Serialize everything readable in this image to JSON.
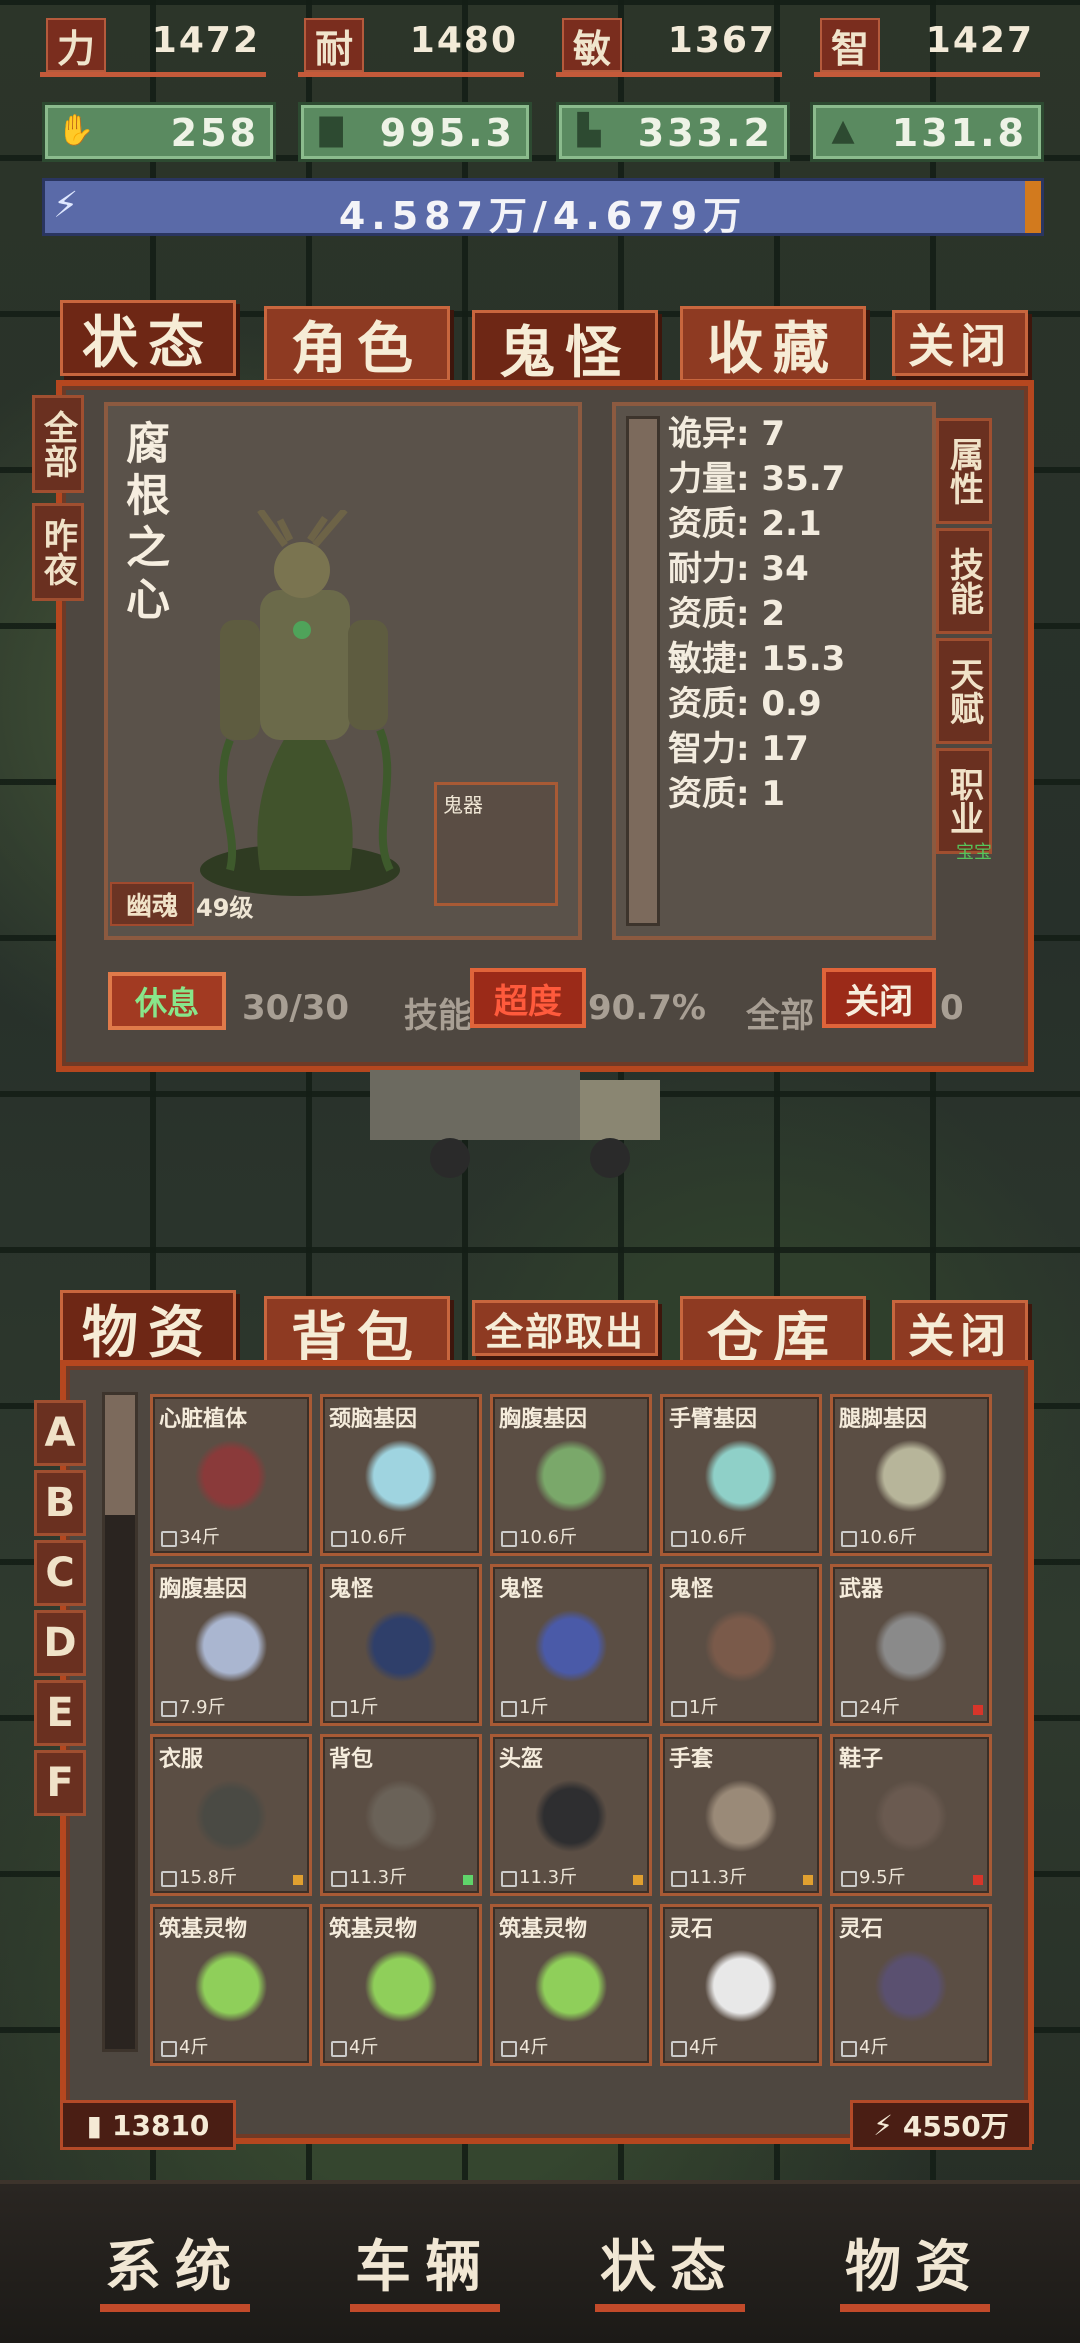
{
  "stats": [
    {
      "label": "力",
      "value": "1472"
    },
    {
      "label": "耐",
      "value": "1480"
    },
    {
      "label": "敏",
      "value": "1367"
    },
    {
      "label": "智",
      "value": "1427"
    }
  ],
  "equip": [
    {
      "icon": "hand-icon",
      "value": "258"
    },
    {
      "icon": "shirt-icon",
      "value": "995.3"
    },
    {
      "icon": "boot-icon",
      "value": "333.2"
    },
    {
      "icon": "helmet-icon",
      "value": "131.8"
    }
  ],
  "energy": {
    "text": "4.587万/4.679万",
    "fill": 0.98
  },
  "top_tabs": {
    "status": "状态",
    "role": "角色",
    "ghost": "鬼怪",
    "collect": "收藏",
    "close": "关闭"
  },
  "left_tabs": {
    "all": "全部",
    "hidden": "昨夜"
  },
  "character": {
    "name": "腐根之心",
    "soul": "幽魂",
    "level": "49级",
    "slot": "鬼器"
  },
  "attributes": [
    "诡异: 7",
    "力量: 35.7",
    "资质: 2.1",
    "耐力: 34",
    "资质: 2",
    "敏捷: 15.3",
    "资质: 0.9",
    "智力: 17",
    "资质: 1"
  ],
  "right_tabs": [
    "属性",
    "技能",
    "天赋",
    "职业"
  ],
  "right_tag": "宝宝",
  "panel_footer": {
    "rest": "休息",
    "count": "30/30",
    "skill": "技能",
    "super": "超度",
    "percent": "90.7%",
    "all": "全部",
    "close": "关闭",
    "tail": "0"
  },
  "inv_tabs": {
    "goods": "物资",
    "bag": "背包",
    "take_all": "全部取出",
    "warehouse": "仓库",
    "close": "关闭"
  },
  "inv_letters": [
    "A",
    "B",
    "C",
    "D",
    "E",
    "F"
  ],
  "items": [
    {
      "name": "心脏植体",
      "weight": "34斤",
      "tag": ""
    },
    {
      "name": "颈脑基因",
      "weight": "10.6斤",
      "tag": ""
    },
    {
      "name": "胸腹基因",
      "weight": "10.6斤",
      "tag": ""
    },
    {
      "name": "手臂基因",
      "weight": "10.6斤",
      "tag": ""
    },
    {
      "name": "腿脚基因",
      "weight": "10.6斤",
      "tag": ""
    },
    {
      "name": "胸腹基因",
      "weight": "7.9斤",
      "tag": ""
    },
    {
      "name": "鬼怪",
      "weight": "1斤",
      "tag": ""
    },
    {
      "name": "鬼怪",
      "weight": "1斤",
      "tag": ""
    },
    {
      "name": "鬼怪",
      "weight": "1斤",
      "tag": ""
    },
    {
      "name": "武器",
      "weight": "24斤",
      "tag": "#d8352a"
    },
    {
      "name": "衣服",
      "weight": "15.8斤",
      "tag": "#e0a030"
    },
    {
      "name": "背包",
      "weight": "11.3斤",
      "tag": "#5fd46a"
    },
    {
      "name": "头盔",
      "weight": "11.3斤",
      "tag": "#e0a030"
    },
    {
      "name": "手套",
      "weight": "11.3斤",
      "tag": "#e0a030"
    },
    {
      "name": "鞋子",
      "weight": "9.5斤",
      "tag": "#d8352a"
    },
    {
      "name": "筑基灵物",
      "weight": "4斤",
      "tag": ""
    },
    {
      "name": "筑基灵物",
      "weight": "4斤",
      "tag": ""
    },
    {
      "name": "筑基灵物",
      "weight": "4斤",
      "tag": ""
    },
    {
      "name": "灵石",
      "weight": "4斤",
      "tag": ""
    },
    {
      "name": "灵石",
      "weight": "4斤",
      "tag": ""
    }
  ],
  "footer": {
    "weight": "13810",
    "money": "4550万"
  },
  "nav": [
    "系统",
    "车辆",
    "状态",
    "物资"
  ]
}
